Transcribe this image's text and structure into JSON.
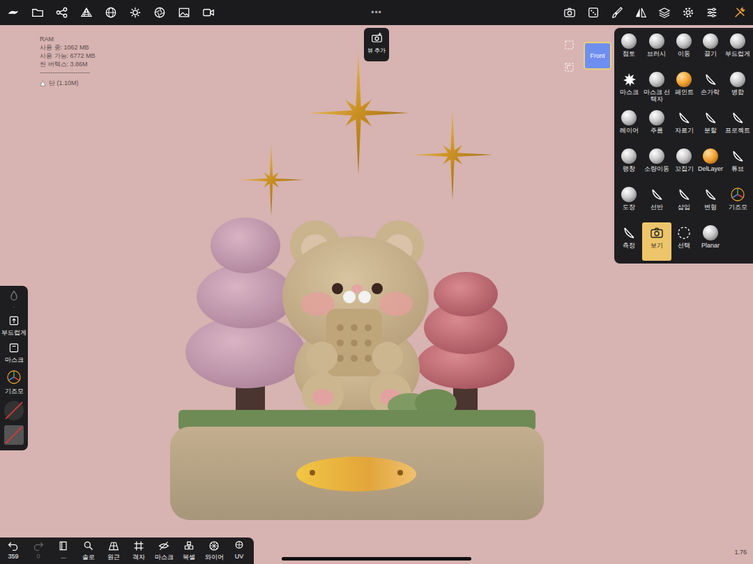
{
  "top_toolbar": {
    "handle": "•••"
  },
  "memory": {
    "title": "RAM",
    "lines": [
      "사용 중: 1062 MB",
      "사용 가능: 6772 MB",
      "씬 버텍스: 3.86M",
      "------------------------"
    ],
    "mesh": "단 (1.10M)"
  },
  "add_view": {
    "label": "뷰 추가"
  },
  "view_cube": {
    "label": "Front"
  },
  "tools": [
    {
      "label": "점토",
      "kind": "sphere",
      "selected": false
    },
    {
      "label": "브러시",
      "kind": "sphere",
      "selected": false
    },
    {
      "label": "이동",
      "kind": "sphere",
      "selected": false
    },
    {
      "label": "끌기",
      "kind": "sphere",
      "selected": false
    },
    {
      "label": "부드럽게",
      "kind": "sphere",
      "selected": false
    },
    {
      "label": "마스크",
      "kind": "splat",
      "selected": false
    },
    {
      "label": "마스크 선택자",
      "kind": "sphere",
      "selected": false
    },
    {
      "label": "페인트",
      "kind": "orange",
      "selected": false
    },
    {
      "label": "손가락",
      "kind": "line",
      "selected": false
    },
    {
      "label": "병합",
      "kind": "sphere",
      "selected": false
    },
    {
      "label": "레이어",
      "kind": "sphere",
      "selected": false
    },
    {
      "label": "주름",
      "kind": "sphere",
      "selected": false
    },
    {
      "label": "자르기",
      "kind": "line",
      "selected": false
    },
    {
      "label": "분할",
      "kind": "line",
      "selected": false
    },
    {
      "label": "프로젝트",
      "kind": "line",
      "selected": false
    },
    {
      "label": "팽창",
      "kind": "sphere",
      "selected": false
    },
    {
      "label": "소량이동",
      "kind": "sphere",
      "selected": false
    },
    {
      "label": "꼬집기",
      "kind": "sphere",
      "selected": false
    },
    {
      "label": "DelLayer",
      "kind": "orange",
      "selected": false
    },
    {
      "label": "튜브",
      "kind": "line",
      "selected": false
    },
    {
      "label": "도장",
      "kind": "sphere",
      "selected": false
    },
    {
      "label": "선반",
      "kind": "line",
      "selected": false
    },
    {
      "label": "삽입",
      "kind": "line",
      "selected": false
    },
    {
      "label": "변형",
      "kind": "line",
      "selected": false
    },
    {
      "label": "기즈모",
      "kind": "gizmo",
      "selected": false
    },
    {
      "label": "측정",
      "kind": "line",
      "selected": false
    },
    {
      "label": "보기",
      "kind": "camera",
      "selected": true
    },
    {
      "label": "선택",
      "kind": "dashed",
      "selected": false
    },
    {
      "label": "Planar",
      "kind": "sphere",
      "selected": false
    }
  ],
  "side_panel": {
    "items": [
      {
        "label": "·",
        "kind": "drop"
      },
      {
        "label": "부드럽게",
        "kind": "upload"
      },
      {
        "label": "마스크",
        "kind": "square"
      },
      {
        "label": "기즈모",
        "kind": "gizmo"
      }
    ],
    "swatches": [
      {
        "kind": "circle",
        "off": true
      },
      {
        "kind": "square",
        "off": true
      }
    ]
  },
  "bottom_bar": [
    {
      "label": "359",
      "kind": "undo",
      "disabled": false
    },
    {
      "label": "0",
      "kind": "redo",
      "disabled": true
    },
    {
      "label": "...",
      "kind": "book",
      "disabled": false
    },
    {
      "label": "솔로",
      "kind": "solo",
      "disabled": false
    },
    {
      "label": "원근",
      "kind": "perspective",
      "disabled": false
    },
    {
      "label": "격자",
      "kind": "grid",
      "disabled": false
    },
    {
      "label": "마스크",
      "kind": "mask",
      "disabled": false
    },
    {
      "label": "복셀",
      "kind": "voxel",
      "disabled": false
    },
    {
      "label": "와이어",
      "kind": "wire",
      "disabled": false
    },
    {
      "label": "UV",
      "kind": "uv",
      "disabled": false
    }
  ],
  "zoom": "1.76"
}
